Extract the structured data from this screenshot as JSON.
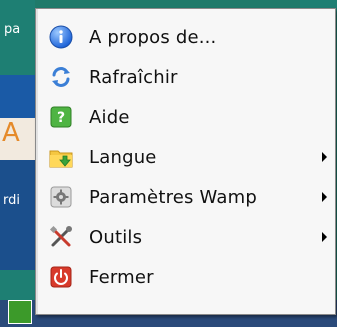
{
  "background": {
    "fragments": [
      "pa",
      "A",
      "rdi"
    ]
  },
  "menu": {
    "items": [
      {
        "label": "A propos de...",
        "icon": "info-icon",
        "submenu": false
      },
      {
        "label": "Rafraîchir",
        "icon": "refresh-icon",
        "submenu": false
      },
      {
        "label": "Aide",
        "icon": "help-icon",
        "submenu": false
      },
      {
        "label": "Langue",
        "icon": "language-folder-icon",
        "submenu": true
      },
      {
        "label": "Paramètres Wamp",
        "icon": "settings-gear-icon",
        "submenu": true
      },
      {
        "label": "Outils",
        "icon": "tools-icon",
        "submenu": true
      },
      {
        "label": "Fermer",
        "icon": "power-icon",
        "submenu": false
      }
    ]
  },
  "colors": {
    "menu_bg": "#f7f7f7",
    "menu_border": "#8a8a8a",
    "desktop_bg": "#1f7a6a"
  }
}
